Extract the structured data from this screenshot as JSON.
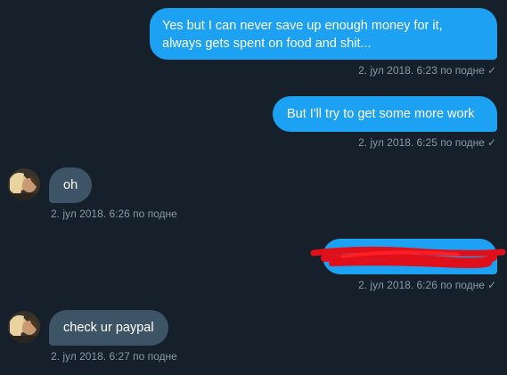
{
  "messages": [
    {
      "direction": "outgoing",
      "lines": [
        "Yes but I can never save up enough money for it,",
        "always gets spent on food and shit..."
      ],
      "timestamp": "2. јул 2018. 6:23 по подне",
      "status_icon": "check-icon"
    },
    {
      "direction": "outgoing",
      "text": "But I'll try to get some more work",
      "timestamp": "2. јул 2018. 6:25 по подне",
      "status_icon": "check-icon"
    },
    {
      "direction": "incoming",
      "text": "oh",
      "timestamp": "2. јул 2018. 6:26 по подне"
    },
    {
      "direction": "outgoing",
      "text": "",
      "redacted": true,
      "timestamp": "2. јул 2018. 6:26 по подне",
      "status_icon": "check-icon"
    },
    {
      "direction": "incoming",
      "text": "check ur paypal",
      "timestamp": "2. јул 2018. 6:27 по подне"
    }
  ],
  "check_glyph": "✓",
  "colors": {
    "background": "#15202b",
    "sent_bubble": "#1da1f2",
    "received_bubble": "#3d5466",
    "meta_text": "#8899a6",
    "redaction": "#e0101a"
  }
}
